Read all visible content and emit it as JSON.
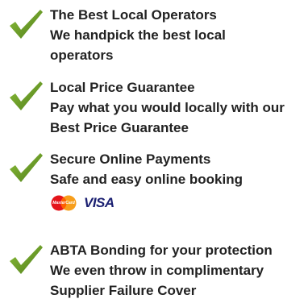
{
  "features": [
    {
      "title": "The Best Local Operators",
      "line1": "We handpick the best local",
      "line2": "operators"
    },
    {
      "title": "Local Price Guarantee",
      "line1": "Pay what you would locally with our",
      "line2": "Best Price Guarantee"
    },
    {
      "title": "Secure Online Payments",
      "line1": "Safe and easy online booking"
    },
    {
      "title": "ABTA Bonding for your protection",
      "line1": "We even throw in complimentary",
      "line2": "Supplier Failure Cover"
    }
  ],
  "payment": {
    "mastercard_label": "MasterCard",
    "visa_label": "VISA"
  },
  "icons": {
    "check": "check-icon",
    "mastercard": "mastercard-icon",
    "visa": "visa-logo"
  },
  "colors": {
    "check_green": "#6f9d2b",
    "text": "#222222",
    "mastercard_red": "#e4141b",
    "mastercard_orange": "#f79e1b",
    "visa_blue": "#1a1f71"
  }
}
